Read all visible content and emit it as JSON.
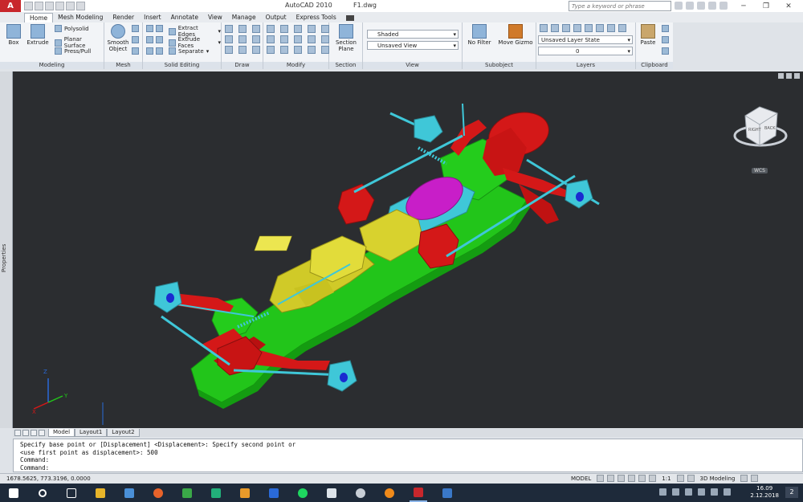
{
  "window": {
    "app_title": "AutoCAD 2010",
    "file_name": "F1.dwg",
    "search_placeholder": "Type a keyword or phrase"
  },
  "tabs": [
    "Home",
    "Mesh Modeling",
    "Render",
    "Insert",
    "Annotate",
    "View",
    "Manage",
    "Output",
    "Express Tools"
  ],
  "ribbon": {
    "modeling": {
      "title": "Modeling",
      "box": "Box",
      "extrude": "Extrude",
      "polysolid": "Polysolid",
      "planar_surface": "Planar Surface",
      "press_pull": "Press/Pull"
    },
    "mesh": {
      "title": "Mesh",
      "smooth_object_1": "Smooth",
      "smooth_object_2": "Object"
    },
    "solid_editing": {
      "title": "Solid Editing",
      "extract_edges": "Extract Edges",
      "extrude_faces": "Extrude Faces",
      "separate": "Separate"
    },
    "draw": {
      "title": "Draw"
    },
    "modify": {
      "title": "Modify"
    },
    "section": {
      "title": "Section",
      "section_plane_1": "Section",
      "section_plane_2": "Plane"
    },
    "view": {
      "title": "View",
      "visual_style": "Shaded",
      "named_view": "Unsaved View"
    },
    "subobject": {
      "title": "Subobject",
      "no_filter": "No Filter",
      "move_gizmo": "Move Gizmo"
    },
    "layers": {
      "title": "Layers",
      "layer_state": "Unsaved Layer State",
      "current_layer": "0"
    },
    "clipboard": {
      "title": "Clipboard",
      "paste": "Paste"
    }
  },
  "viewport": {
    "properties_label": "Properties",
    "viewcube": {
      "right": "RIGHT",
      "back": "BACK",
      "wcs": "WCS"
    },
    "ucs": {
      "z": "Z",
      "y": "Y",
      "x": "X"
    }
  },
  "layout_tabs": [
    "Model",
    "Layout1",
    "Layout2"
  ],
  "command_line": {
    "lines": [
      "Specify base point or [Displacement] <Displacement>: Specify second point or",
      "<use first point as displacement>: 500",
      "Command:"
    ],
    "prompt": "Command:"
  },
  "status": {
    "coordinates": "1678.5625, 773.3196, 0.0000",
    "model": "MODEL",
    "scale": "1:1",
    "workspace": "3D Modeling"
  },
  "taskbar": {
    "time": "16.09",
    "date": "2.12.2018",
    "notifications": "2"
  },
  "colors": {
    "viewport_bg": "#2b2d30",
    "chassis_green": "#22c51a",
    "suspension_red": "#d41818",
    "rod_cyan": "#3fc7d8",
    "body_yellow": "#d8d22e",
    "motor_magenta": "#c81ec8"
  }
}
